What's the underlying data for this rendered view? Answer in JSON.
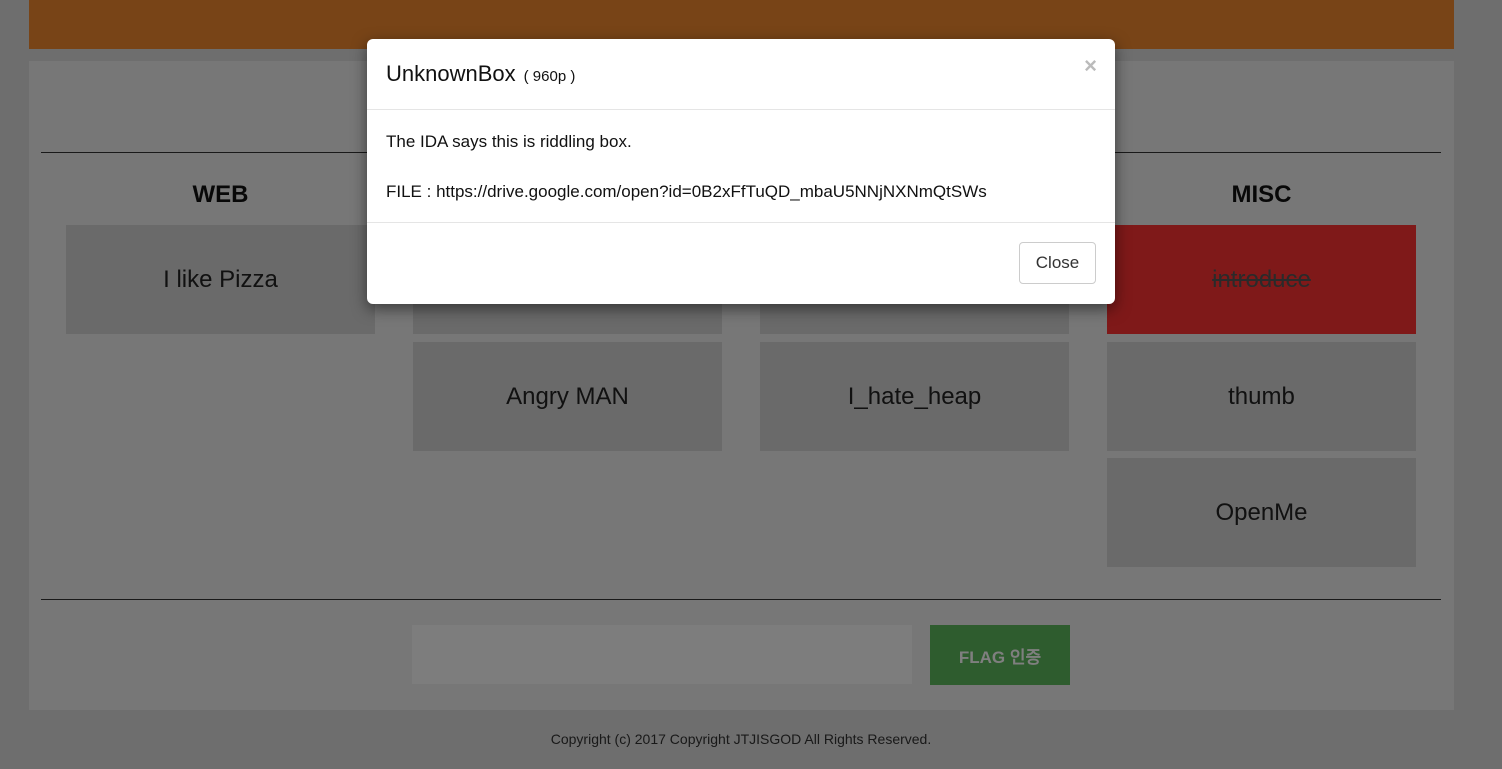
{
  "categories": {
    "web": "WEB",
    "misc": "MISC"
  },
  "challenges": {
    "web_1": "I like Pizza",
    "col2_row2": "Angry MAN",
    "col3_row2": "I_hate_heap",
    "misc_1": "introduce",
    "misc_2": "thumb",
    "misc_3": "OpenMe"
  },
  "flag_form": {
    "input_value": "",
    "button_label": "FLAG 인증"
  },
  "footer": {
    "copyright": "Copyright (c) 2017 Copyright JTJISGOD All Rights Reserved."
  },
  "modal": {
    "title": "UnknownBox",
    "points": "( 960p )",
    "close_x": "×",
    "description": "The IDA says this is riddling box.",
    "file_line": "FILE : https://drive.google.com/open?id=0B2xFfTuQD_mbaU5NNjNXNmQtSWs",
    "close_button": "Close"
  },
  "colors": {
    "header": "#f0882f",
    "solved": "#ff3333",
    "flag_button": "#5cb85c"
  }
}
